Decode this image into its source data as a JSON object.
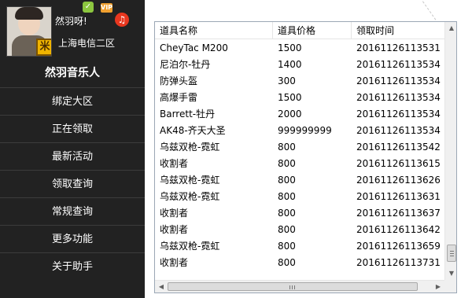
{
  "profile": {
    "username": "然羽呀!",
    "server": "上海电信二区",
    "rank_badge": "米",
    "icons": {
      "status": "vip-status-icon",
      "vip": "vip-badge-icon",
      "music": "music-note-icon"
    },
    "icon_glyphs": {
      "status": "✓",
      "vip": "VIP",
      "music": "♫"
    }
  },
  "menu": {
    "items": [
      {
        "label": "然羽音乐人"
      },
      {
        "label": "绑定大区"
      },
      {
        "label": "正在领取"
      },
      {
        "label": "最新活动"
      },
      {
        "label": "领取查询"
      },
      {
        "label": "常规查询"
      },
      {
        "label": "更多功能"
      },
      {
        "label": "关于助手"
      }
    ]
  },
  "table": {
    "columns": [
      "道具名称",
      "道具价格",
      "领取时间"
    ],
    "rows": [
      [
        "CheyTac M200",
        "1500",
        "20161126113531"
      ],
      [
        "尼泊尔-牡丹",
        "1400",
        "20161126113534"
      ],
      [
        "防弹头盔",
        "300",
        "20161126113534"
      ],
      [
        "高爆手雷",
        "1500",
        "20161126113534"
      ],
      [
        "Barrett-牡丹",
        "2000",
        "20161126113534"
      ],
      [
        "AK48-齐天大圣",
        "999999999",
        "20161126113534"
      ],
      [
        "乌兹双枪-霓虹",
        "800",
        "20161126113542"
      ],
      [
        "收割者",
        "800",
        "20161126113615"
      ],
      [
        "乌兹双枪-霓虹",
        "800",
        "20161126113626"
      ],
      [
        "乌兹双枪-霓虹",
        "800",
        "20161126113631"
      ],
      [
        "收割者",
        "800",
        "20161126113637"
      ],
      [
        "收割者",
        "800",
        "20161126113642"
      ],
      [
        "乌兹双枪-霓虹",
        "800",
        "20161126113659"
      ],
      [
        "收割者",
        "800",
        "20161126113731"
      ]
    ]
  },
  "scrollbars": {
    "vertical_position": 0.95,
    "glyphs": {
      "up": "▲",
      "down": "▼",
      "left": "◀",
      "right": "▶"
    }
  },
  "colors": {
    "sidebar_bg": "#222222",
    "table_border": "#9ba7b5"
  }
}
